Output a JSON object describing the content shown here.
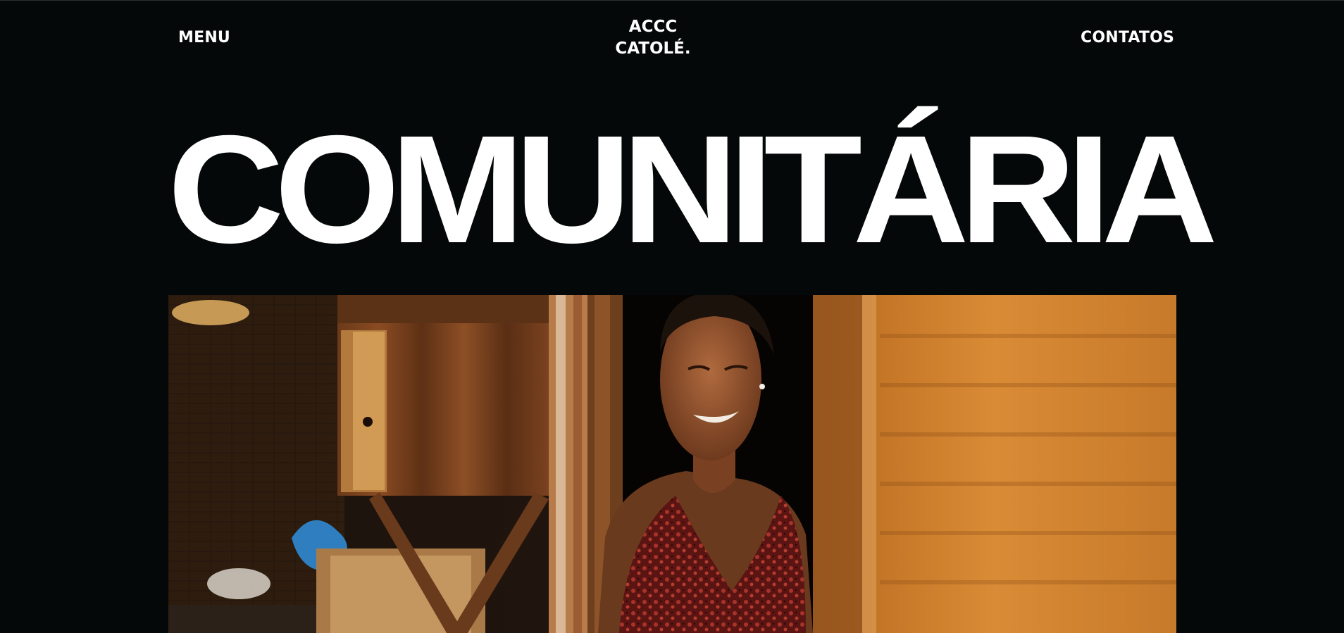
{
  "header": {
    "menu_label": "MENU",
    "logo_line1": "ACCC",
    "logo_line2": "CATOLÉ.",
    "contacts_label": "CONTATOS"
  },
  "hero": {
    "title": "COMUNITÁRIA",
    "image_subject": "smiling woman in a red patterned dress standing in the doorway of a rustic house with a wooden cabinet and adobe wall"
  },
  "colors": {
    "background": "#050808",
    "text": "#ffffff"
  },
  "icons": {
    "photo": "hero-photo"
  }
}
